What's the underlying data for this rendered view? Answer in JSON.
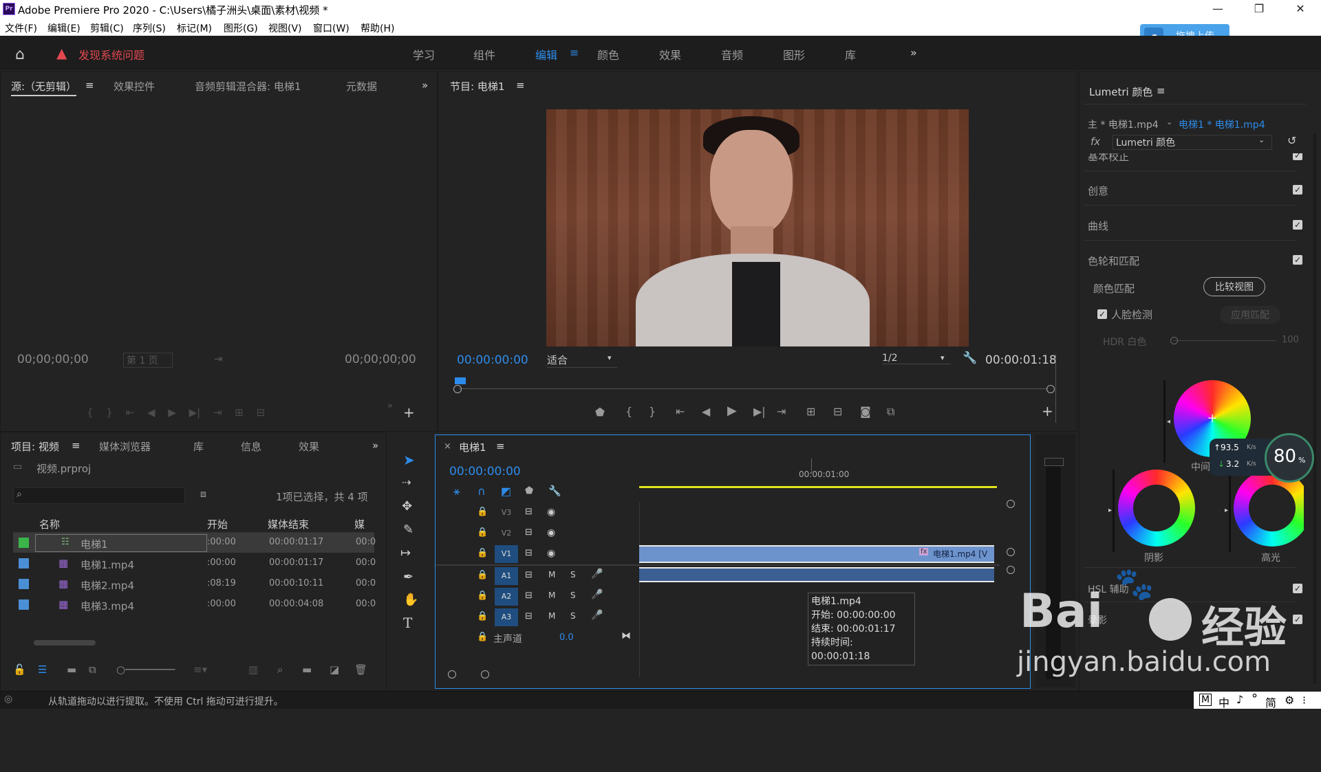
{
  "window": {
    "app_icon_text": "Pr",
    "title": "Adobe Premiere Pro 2020 - C:\\Users\\橘子洲头\\桌面\\素材\\视频 *"
  },
  "menu": [
    "文件(F)",
    "编辑(E)",
    "剪辑(C)",
    "序列(S)",
    "标记(M)",
    "图形(G)",
    "视图(V)",
    "窗口(W)",
    "帮助(H)"
  ],
  "upload_button": "拖拽上传",
  "header": {
    "warning": "发现系统问题",
    "workspaces": [
      "学习",
      "组件",
      "编辑",
      "颜色",
      "效果",
      "音频",
      "图形",
      "库"
    ],
    "active_workspace": "编辑"
  },
  "source_panel": {
    "tabs": [
      "源:（无剪辑）",
      "效果控件",
      "音频剪辑混合器: 电梯1",
      "元数据"
    ],
    "tc_left": "00;00;00;00",
    "page": "第 1 页",
    "tc_right": "00;00;00;00"
  },
  "program_panel": {
    "title": "节目: 电梯1",
    "tc_current": "00:00:00:00",
    "fit": "适合",
    "resolution": "1/2",
    "tc_duration": "00:00:01:18"
  },
  "project_panel": {
    "tabs": [
      "项目: 视频",
      "媒体浏览器",
      "库",
      "信息",
      "效果"
    ],
    "file": "视频.prproj",
    "selection_info": "1项已选择，共 4 项",
    "columns": [
      "名称",
      "开始",
      "媒体结束",
      "媒体"
    ],
    "rows": [
      {
        "name": "电梯1",
        "start": ":00:00",
        "end": "00:00:01:17",
        "media": "00:0",
        "color": "#3bb54a"
      },
      {
        "name": "电梯1.mp4",
        "start": ":00:00",
        "end": "00:00:01:17",
        "media": "00:0",
        "color": "#4a8fd6"
      },
      {
        "name": "电梯2.mp4",
        "start": ":08:19",
        "end": "00:00:10:11",
        "media": "00:0",
        "color": "#4a8fd6"
      },
      {
        "name": "电梯3.mp4",
        "start": ":00:00",
        "end": "00:00:04:08",
        "media": "00:0",
        "color": "#4a8fd6"
      }
    ]
  },
  "timeline": {
    "tab": "电梯1",
    "timecode": "00:00:00:00",
    "ruler_mark": "00:00:01:00",
    "tracks": [
      "V3",
      "V2",
      "V1",
      "A1",
      "A2",
      "A3"
    ],
    "master_label": "主声道",
    "master_value": "0.0",
    "clip_label": "电梯1.mp4 [V",
    "tooltip": [
      "电梯1.mp4",
      "开始: 00:00:00:00",
      "结束: 00:00:01:17",
      "持续时间: 00:00:01:18"
    ]
  },
  "lumetri": {
    "title": "Lumetri 颜色",
    "master": "主 * 电梯1.mp4",
    "clip": "电梯1 * 电梯1.mp4",
    "fx_select": "Lumetri 颜色",
    "sections": [
      "基本校正",
      "创意",
      "曲线",
      "色轮和匹配"
    ],
    "color_match": "颜色匹配",
    "compare_button": "比较视图",
    "face_detect": "人脸检测",
    "apply_match": "应用匹配",
    "hdr_label": "HDR 白色",
    "hdr_value": "100",
    "wheels": [
      "中间调",
      "阴影",
      "高光"
    ],
    "sections_lower": [
      "HSL 辅助",
      "晕影"
    ]
  },
  "net_widget": {
    "up": "93.5",
    "down": "3.2",
    "unit": "K/s",
    "percent": "80",
    "percent_unit": "%"
  },
  "status": {
    "text": "从轨道拖动以进行提取。不使用 Ctrl 拖动可进行提升。"
  },
  "tray": [
    "M",
    "中",
    "♪",
    "°",
    "简",
    "⚙",
    "⁝"
  ],
  "watermark": {
    "logo": "Bai",
    "logo2": "经验",
    "url": "jingyan.baidu.com"
  }
}
